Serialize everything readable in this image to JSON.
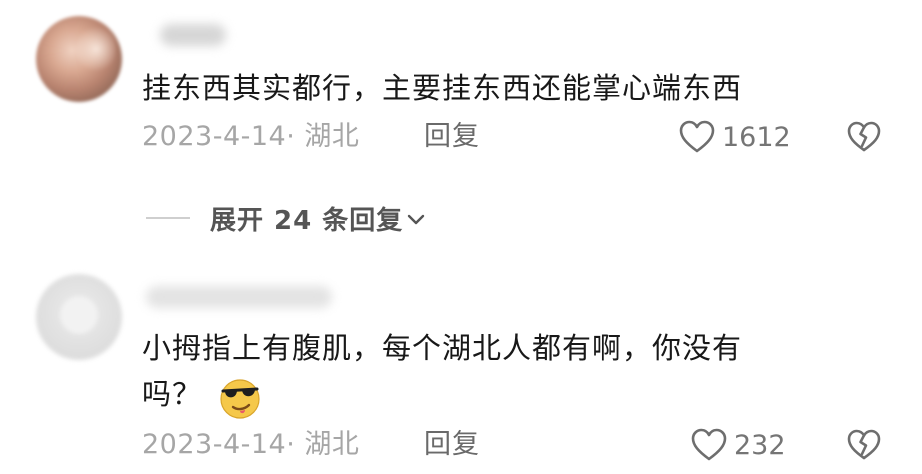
{
  "comments": [
    {
      "text": "挂东西其实都行，主要挂东西还能掌心端东西",
      "date_location": "2023-4-14· 湖北",
      "reply_label": "回复",
      "like_count": "1612",
      "expand": {
        "label": "展开 24 条回复"
      }
    },
    {
      "text_line1": "小拇指上有腹肌，每个湖北人都有啊，你没有",
      "text_line2": "吗？",
      "emoji": "cool-sunglasses-emoji",
      "date_location": "2023-4-14· 湖北",
      "reply_label": "回复",
      "like_count": "232"
    }
  ],
  "icons": {
    "like": "heart-outline-icon",
    "dislike": "broken-heart-icon",
    "expand": "chevron-down-icon"
  },
  "colors": {
    "text_primary": "#181818",
    "text_meta": "#a6a6a6",
    "reply": "#6a6a6a",
    "icon": "#6e6e6e",
    "emoji_face": "#f5c84a"
  }
}
